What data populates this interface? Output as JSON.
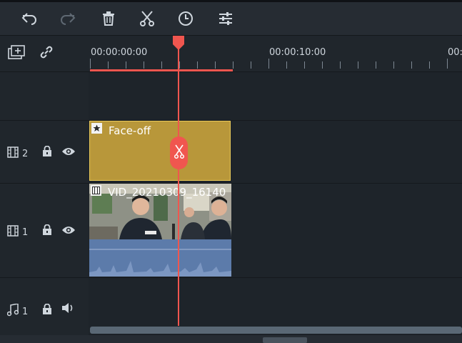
{
  "toolbar": {
    "buttons": [
      {
        "name": "undo",
        "icon": "undo-icon"
      },
      {
        "name": "redo",
        "icon": "redo-icon"
      },
      {
        "name": "delete",
        "icon": "trash-icon"
      },
      {
        "name": "split",
        "icon": "scissors-icon"
      },
      {
        "name": "duration",
        "icon": "clock-icon"
      },
      {
        "name": "adjust",
        "icon": "sliders-icon"
      }
    ]
  },
  "header": {
    "add_track_icon": "add-track-icon",
    "link_icon": "link-icon"
  },
  "ruler": {
    "labels": [
      "00:00:00:00",
      "00:00:10:00",
      "00:"
    ]
  },
  "tracks": [
    {
      "type": "empty",
      "label": ""
    },
    {
      "type": "video",
      "number": "2",
      "icon": "film-icon",
      "lock_icon": "lock-icon",
      "visibility_icon": "eye-icon"
    },
    {
      "type": "video",
      "number": "1",
      "icon": "film-icon",
      "lock_icon": "lock-icon",
      "visibility_icon": "eye-icon"
    },
    {
      "type": "audio",
      "number": "1",
      "icon": "music-note-icon",
      "lock_icon": "lock-icon",
      "volume_icon": "speaker-icon"
    }
  ],
  "clips": {
    "title_clip": {
      "name": "Face-off",
      "badge_icon": "star-icon"
    },
    "video_clip": {
      "name": "VID_20210309_16140",
      "badge_icon": "film-icon"
    }
  },
  "colors": {
    "playhead": "#f0564f",
    "title_clip": "#b8973a",
    "audio_wave": "#5c7baa",
    "background": "#1b2026"
  }
}
